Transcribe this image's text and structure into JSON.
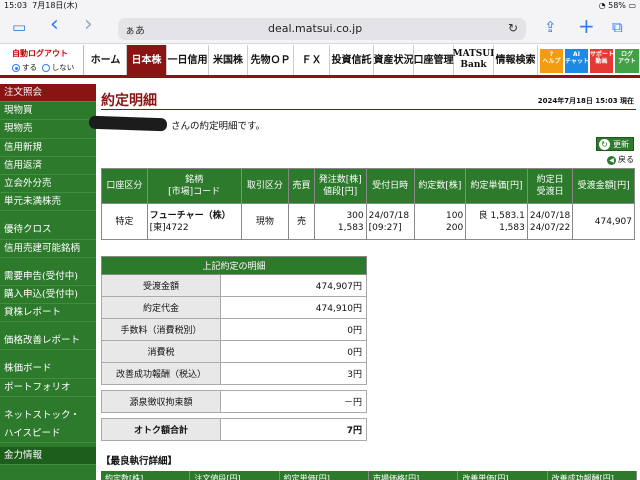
{
  "statusbar": {
    "time": "15:03",
    "date": "7月18日(木)",
    "battery": "58%"
  },
  "browser": {
    "tab_toggle": "▭",
    "back": "‹",
    "forward": "›",
    "text_size": "ぁあ",
    "url": "deal.matsui.co.jp",
    "reload": "↻",
    "share": "⇪",
    "new_tab": "+",
    "tabs": "⧉"
  },
  "nav": {
    "auto_logout": {
      "title": "自動ログアウト",
      "option_on": "する",
      "option_off": "しない"
    },
    "tabs": [
      "ホーム",
      "日本株",
      "一日信用",
      "米国株",
      "先物ＯＰ",
      "ＦＸ",
      "投資信託",
      "資産状況",
      "口座管理",
      "MATSUI Bank",
      "情報検索"
    ],
    "icons": [
      {
        "label": "?\nヘルプ",
        "color": "#f39c12"
      },
      {
        "label": "AI\nチャット",
        "color": "#1e88e5"
      },
      {
        "label": "サポート\n動画",
        "color": "#e53935"
      },
      {
        "label": "ログ\nアウト",
        "color": "#43a047"
      }
    ]
  },
  "sidebar": {
    "items": [
      "注文照会",
      "現物買",
      "現物売",
      "信用新規",
      "信用返済",
      "立会外分売",
      "単元未満株売",
      "",
      "優待クロス",
      "信用売建可能銘柄",
      "",
      "需要申告(受付中)",
      "購入申込(受付中)",
      "貸株レポート",
      "",
      "価格改善レポート",
      "",
      "株価ボード",
      "ポートフォリオ",
      "",
      "ネットストック・",
      "ハイスピード",
      "金力情報"
    ]
  },
  "main": {
    "page_title": "約定明細",
    "datetime": "2024年7月18日 15:03 現在",
    "message": "さんの約定明細です。",
    "refresh_label": "更新",
    "back_label": "戻る",
    "order_table": {
      "headers": [
        "口座区分",
        "銘柄\n[市場]コード",
        "取引区分",
        "売買",
        "発注数[株]\n値段[円]",
        "受付日時",
        "約定数[株]",
        "約定単価[円]",
        "約定日\n受渡日",
        "受渡金額[円]"
      ],
      "row": {
        "account": "特定",
        "stock_name": "フューチャー（株）",
        "stock_code": "[東]4722",
        "trade_type": "現物",
        "side": "売",
        "order_qty": "300",
        "order_price": "1,583",
        "received_date": "24/07/18",
        "received_time": "[09:27]",
        "exec_qty1": "100",
        "exec_qty2": "200",
        "exec_price1": "良 1,583.1",
        "exec_price2": "1,583",
        "exec_date": "24/07/18",
        "settle_date": "24/07/22",
        "settle_amount": "474,907"
      }
    },
    "detail_table": {
      "header": "上記約定の明細",
      "rows": [
        {
          "label": "受渡金額",
          "value": "474,907円"
        },
        {
          "label": "約定代金",
          "value": "474,910円"
        },
        {
          "label": "手数料（消費税別）",
          "value": "0円"
        },
        {
          "label": "消費税",
          "value": "0円"
        },
        {
          "label": "改善成功報酬（税込）",
          "value": "3円"
        }
      ],
      "withholding": {
        "label": "源泉徴収拘束額",
        "value": "－円"
      },
      "total": {
        "label": "オトク額合計",
        "value": "7円"
      }
    },
    "best_execution": {
      "title": "【最良執行詳細】",
      "headers": [
        "約定数[株]",
        "注文値段[円]",
        "約定単価[円]",
        "市場価格[円]",
        "改善単価[円]",
        "改善成功報酬[円]"
      ]
    }
  }
}
